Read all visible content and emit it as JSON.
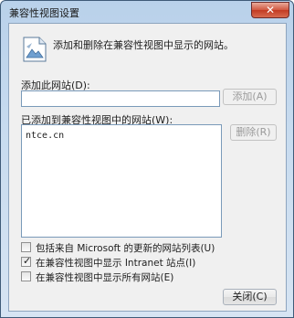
{
  "window": {
    "title": "兼容性视图设置",
    "close_glyph": "✕"
  },
  "intro": {
    "text": "添加和删除在兼容性视图中显示的网站。",
    "icon": "compatibility-view-icon"
  },
  "add_site": {
    "label": "添加此网站(D):",
    "value": "",
    "button_label": "添加(A)"
  },
  "site_list": {
    "label": "已添加到兼容性视图中的网站(W):",
    "items": [
      "ntce.cn"
    ],
    "remove_label": "删除(R)"
  },
  "options": [
    {
      "label": "包括来自 Microsoft 的更新的网站列表(U)",
      "checked": false
    },
    {
      "label": "在兼容性视图中显示 Intranet 站点(I)",
      "checked": true
    },
    {
      "label": "在兼容性视图中显示所有网站(E)",
      "checked": false
    }
  ],
  "footer": {
    "close_label": "关闭(C)"
  }
}
